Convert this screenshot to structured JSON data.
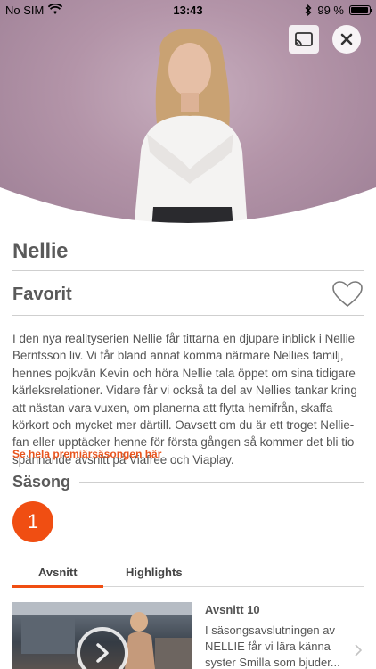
{
  "status": {
    "carrier": "No SIM",
    "time": "13:43",
    "battery_text": "99 %",
    "battery_level": 0.99
  },
  "show": {
    "title": "Nellie",
    "favorite_label": "Favorit",
    "description": "I den nya realityserien Nellie får tittarna en djupare inblick i Nellie Berntsson liv. Vi får bland annat komma närmare Nellies familj, hennes pojkvän Kevin och höra Nellie tala öppet om sina tidigare kärleksrelationer. Vidare får vi också ta del av Nellies tankar kring att nästan vara vuxen, om planerna att flytta hemifrån, skaffa körkort och mycket mer därtill. Oavsett om du är ett troget Nellie-fan eller upptäcker henne för första gången så kommer det bli tio spännande avsnitt på Viafree och Viaplay.",
    "premiere_link": "Se hela premiärsäsongen här"
  },
  "season": {
    "label": "Säsong",
    "selected": "1"
  },
  "tabs": [
    {
      "label": "Avsnitt",
      "active": true
    },
    {
      "label": "Highlights",
      "active": false
    }
  ],
  "episodes": [
    {
      "title": "Avsnitt 10",
      "description": "I säsongsavslutningen av NELLIE får vi lära känna syster Smilla som bjuder..."
    }
  ],
  "colors": {
    "accent": "#f04e12",
    "link": "#e8541e",
    "text": "#555555"
  },
  "icons": [
    "wifi-icon",
    "bluetooth-icon",
    "battery-icon",
    "cast-icon",
    "close-icon",
    "heart-icon",
    "play-icon",
    "chevron-right-icon"
  ]
}
